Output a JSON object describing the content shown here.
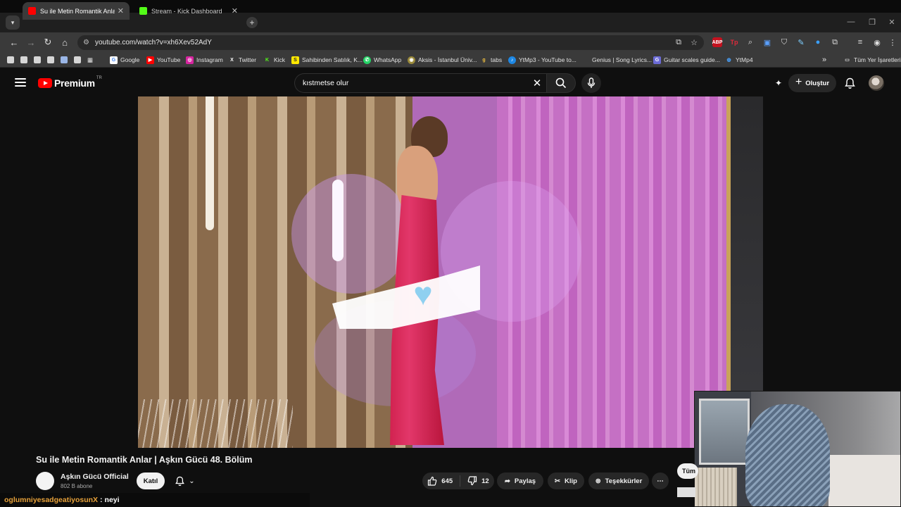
{
  "browser": {
    "tabs": [
      {
        "label": "Su ile Metin Romantik Anlar | Aşkın Gücü 48. Bölüm",
        "favicon_color": "#ff0000",
        "active": true
      },
      {
        "label": "Stream - Kick Dashboard",
        "favicon_color": "#53fc18",
        "active": false
      }
    ],
    "new_tab_symbol": "+",
    "tab_close_symbol": "✕",
    "url": "youtube.com/watch?v=xh6Xev52AdY",
    "extensions": [
      {
        "name": "adblock",
        "label": "ABP",
        "color": "#c4121f"
      },
      {
        "name": "tp",
        "label": "Tp",
        "color": "#d11c2a"
      }
    ]
  },
  "bookmarks": {
    "items": [
      {
        "label": "Google",
        "icon": "google-icon",
        "color": "#ffffff",
        "glyph": "G"
      },
      {
        "label": "YouTube",
        "icon": "youtube-icon",
        "color": "#ff0000",
        "glyph": "▶"
      },
      {
        "label": "Instagram",
        "icon": "instagram-icon",
        "color": "#d6249f",
        "glyph": "◎"
      },
      {
        "label": "Twitter",
        "icon": "x-icon",
        "color": "#3a3a3a",
        "glyph": "X"
      },
      {
        "label": "Kick",
        "icon": "kick-icon",
        "color": "#53fc18",
        "glyph": "K"
      },
      {
        "label": "Sahibinden Satılık, K...",
        "icon": "sahibinden-icon",
        "color": "#ffe800",
        "glyph": "S"
      },
      {
        "label": "WhatsApp",
        "icon": "whatsapp-icon",
        "color": "#25d366",
        "glyph": "✆"
      },
      {
        "label": "Aksis - İstanbul Üniv...",
        "icon": "aksis-icon",
        "color": "#9a8a3a",
        "glyph": "◉"
      },
      {
        "label": "tabs",
        "icon": "tabs-icon",
        "color": "#3a3a3a",
        "glyph": "ɡ"
      },
      {
        "label": "YtMp3 - YouTube to...",
        "icon": "ytmp3-icon",
        "color": "#1e88e5",
        "glyph": "♪"
      },
      {
        "label": "Genius | Song Lyrics...",
        "icon": "genius-icon",
        "color": "#3a3a3a",
        "glyph": ""
      },
      {
        "label": "Guitar scales guide...",
        "icon": "guitar-icon",
        "color": "#6b6bd6",
        "glyph": "G"
      },
      {
        "label": "YtMp4",
        "icon": "ytmp4-icon",
        "color": "#3a3a3a",
        "glyph": "◍"
      }
    ],
    "more_symbol": "»",
    "all_bookmarks_label": "Tüm Yer İşaretleri"
  },
  "youtube": {
    "logo_text": "Premium",
    "country_code": "TR",
    "search_value": "kıstmetse olur",
    "create_label": "Oluştur",
    "accent_color": "#ff0000"
  },
  "video": {
    "title": "Su ile Metin Romantik Anlar | Aşkın Gücü 48. Bölüm",
    "channel_name": "Aşkın Gücü Official",
    "subscribers": "802 B abone",
    "join_label": "Katıl",
    "likes": "645",
    "dislikes": "12",
    "share_label": "Paylaş",
    "clip_label": "Klip",
    "thanks_label": "Teşekkürler",
    "more_symbol": "⋯",
    "all_chip_label": "Tüm"
  },
  "chat": {
    "username": "oglumniyesadgeatiyosunX",
    "separator": ":",
    "message": "neyi"
  }
}
